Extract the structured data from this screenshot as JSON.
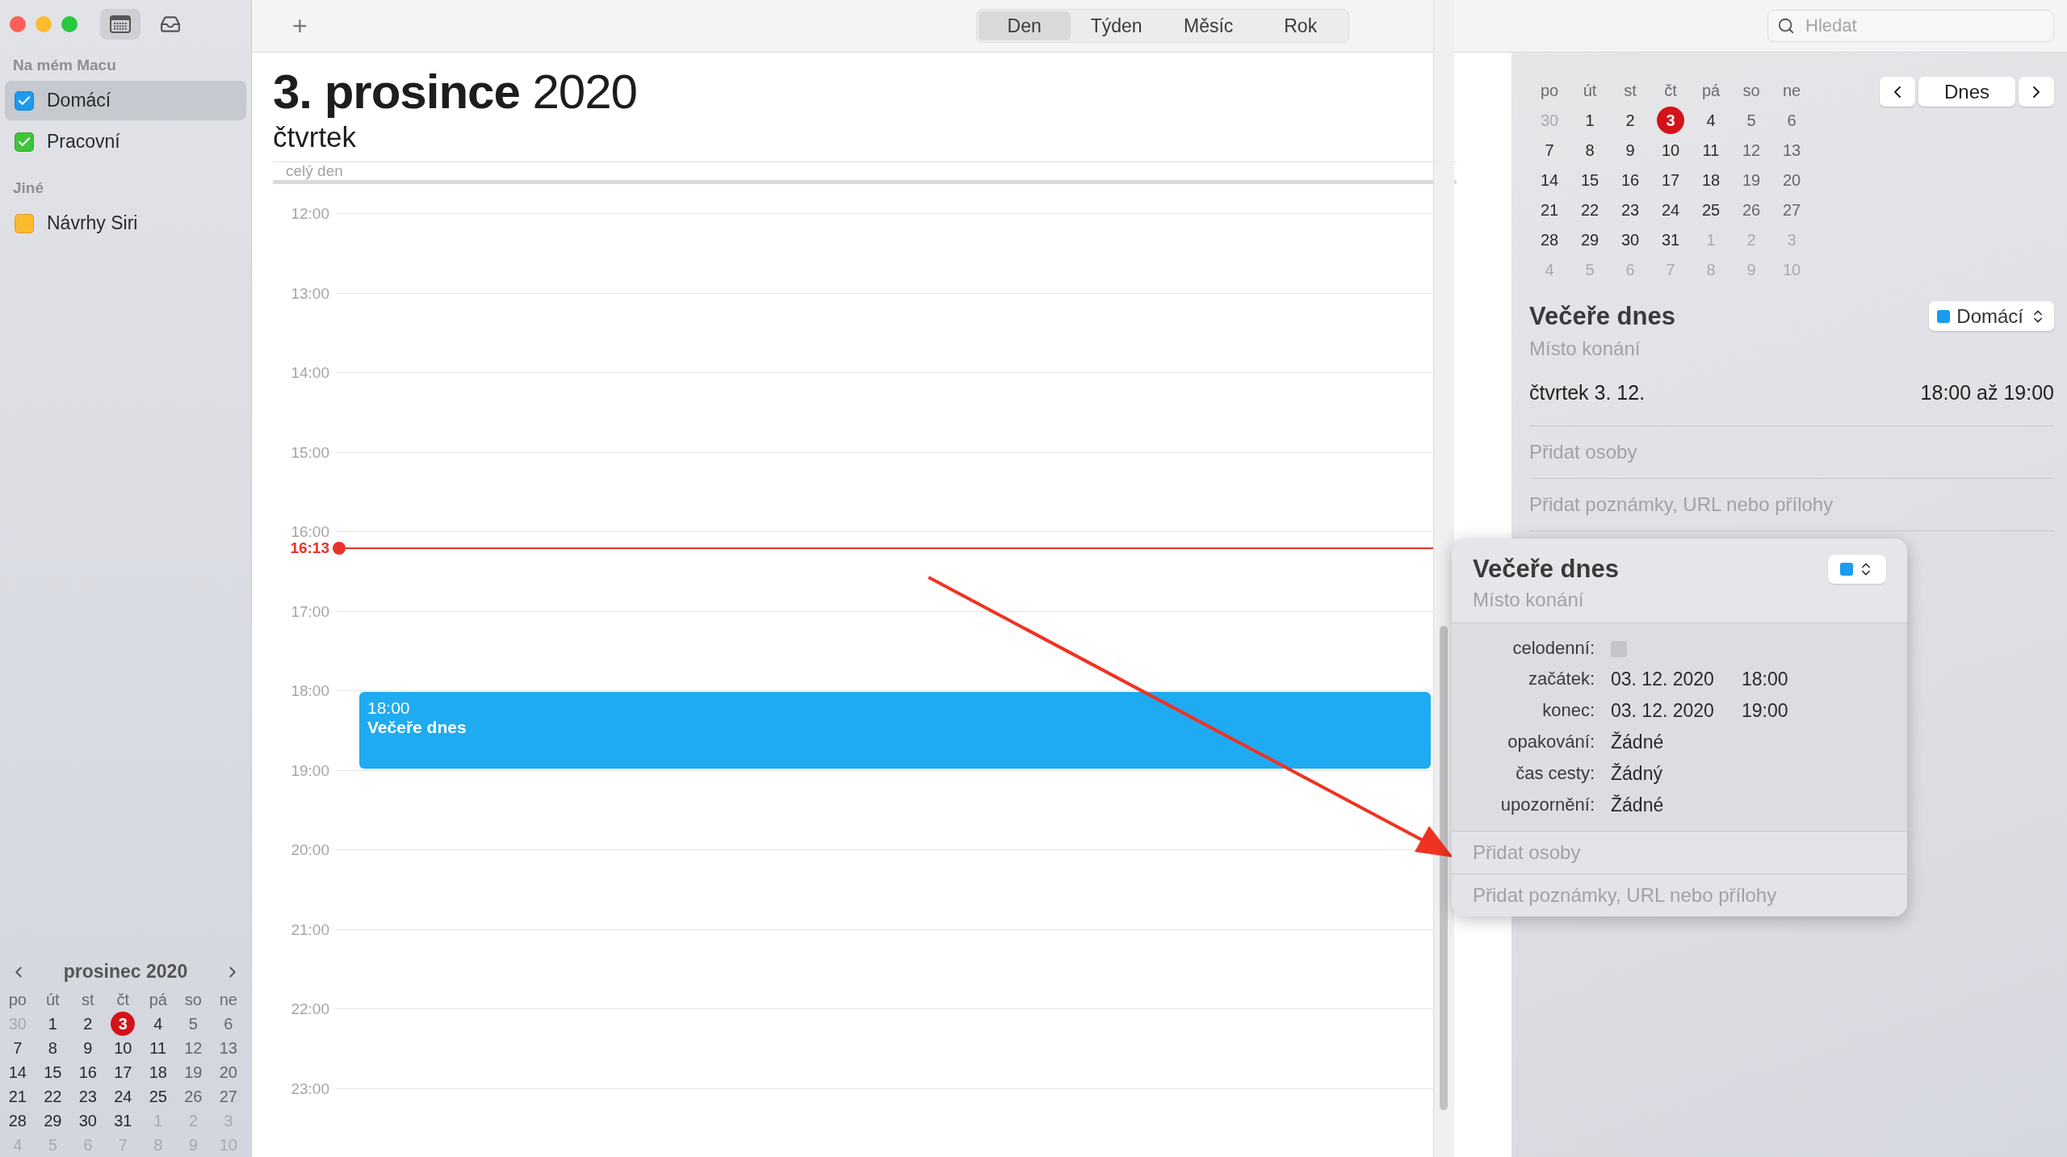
{
  "toolbar": {
    "add_button": "+",
    "view_tabs": [
      {
        "label": "Den",
        "selected": true
      },
      {
        "label": "Týden",
        "selected": false
      },
      {
        "label": "Měsíc",
        "selected": false
      },
      {
        "label": "Rok",
        "selected": false
      }
    ],
    "search": {
      "placeholder": "Hledat"
    }
  },
  "sidebar": {
    "sections": [
      {
        "title": "Na mém Macu",
        "calendars": [
          {
            "name": "Domácí",
            "checked": true,
            "selected": true,
            "color": "#1a9bf0"
          },
          {
            "name": "Pracovní",
            "checked": true,
            "selected": false,
            "color": "#3fc43a"
          }
        ]
      },
      {
        "title": "Jiné",
        "calendars": [
          {
            "name": "Návrhy Siri",
            "checked": false,
            "selected": false,
            "color": "#fdb92d"
          }
        ]
      }
    ],
    "mini_calendar": {
      "title": "prosinec 2020",
      "weekdays": [
        "po",
        "út",
        "st",
        "čt",
        "pá",
        "so",
        "ne"
      ],
      "weeks": [
        [
          {
            "day": "30",
            "in_month": false,
            "today": false
          },
          {
            "day": "1",
            "in_month": true,
            "today": false
          },
          {
            "day": "2",
            "in_month": true,
            "today": false
          },
          {
            "day": "3",
            "in_month": true,
            "today": true
          },
          {
            "day": "4",
            "in_month": true,
            "today": false
          },
          {
            "day": "5",
            "in_month": true,
            "today": false
          },
          {
            "day": "6",
            "in_month": true,
            "today": false
          }
        ],
        [
          {
            "day": "7",
            "in_month": true,
            "today": false
          },
          {
            "day": "8",
            "in_month": true,
            "today": false
          },
          {
            "day": "9",
            "in_month": true,
            "today": false
          },
          {
            "day": "10",
            "in_month": true,
            "today": false
          },
          {
            "day": "11",
            "in_month": true,
            "today": false
          },
          {
            "day": "12",
            "in_month": true,
            "today": false
          },
          {
            "day": "13",
            "in_month": true,
            "today": false
          }
        ],
        [
          {
            "day": "14",
            "in_month": true,
            "today": false
          },
          {
            "day": "15",
            "in_month": true,
            "today": false
          },
          {
            "day": "16",
            "in_month": true,
            "today": false
          },
          {
            "day": "17",
            "in_month": true,
            "today": false
          },
          {
            "day": "18",
            "in_month": true,
            "today": false
          },
          {
            "day": "19",
            "in_month": true,
            "today": false
          },
          {
            "day": "20",
            "in_month": true,
            "today": false
          }
        ],
        [
          {
            "day": "21",
            "in_month": true,
            "today": false
          },
          {
            "day": "22",
            "in_month": true,
            "today": false
          },
          {
            "day": "23",
            "in_month": true,
            "today": false
          },
          {
            "day": "24",
            "in_month": true,
            "today": false
          },
          {
            "day": "25",
            "in_month": true,
            "today": false
          },
          {
            "day": "26",
            "in_month": true,
            "today": false
          },
          {
            "day": "27",
            "in_month": true,
            "today": false
          }
        ],
        [
          {
            "day": "28",
            "in_month": true,
            "today": false
          },
          {
            "day": "29",
            "in_month": true,
            "today": false
          },
          {
            "day": "30",
            "in_month": true,
            "today": false
          },
          {
            "day": "31",
            "in_month": true,
            "today": false
          },
          {
            "day": "1",
            "in_month": false,
            "today": false
          },
          {
            "day": "2",
            "in_month": false,
            "today": false
          },
          {
            "day": "3",
            "in_month": false,
            "today": false
          }
        ],
        [
          {
            "day": "4",
            "in_month": false,
            "today": false
          },
          {
            "day": "5",
            "in_month": false,
            "today": false
          },
          {
            "day": "6",
            "in_month": false,
            "today": false
          },
          {
            "day": "7",
            "in_month": false,
            "today": false
          },
          {
            "day": "8",
            "in_month": false,
            "today": false
          },
          {
            "day": "9",
            "in_month": false,
            "today": false
          },
          {
            "day": "10",
            "in_month": false,
            "today": false
          }
        ]
      ]
    }
  },
  "day_view": {
    "date": "3. prosince",
    "year": "2020",
    "weekday": "čtvrtek",
    "all_day_label": "celý den",
    "hours": [
      "12:00",
      "13:00",
      "14:00",
      "15:00",
      "16:00",
      "17:00",
      "18:00",
      "19:00",
      "20:00",
      "21:00",
      "22:00",
      "23:00"
    ],
    "now_time": "16:13",
    "events": [
      {
        "time": "18:00",
        "title": "Večeře dnes",
        "color": "#1fabf1"
      }
    ]
  },
  "inspector": {
    "mini_calendar": {
      "weekdays": [
        "po",
        "út",
        "st",
        "čt",
        "pá",
        "so",
        "ne"
      ],
      "weeks": [
        [
          {
            "day": "30",
            "in_month": false,
            "today": false
          },
          {
            "day": "1",
            "in_month": true,
            "today": false
          },
          {
            "day": "2",
            "in_month": true,
            "today": false
          },
          {
            "day": "3",
            "in_month": true,
            "today": true
          },
          {
            "day": "4",
            "in_month": true,
            "today": false
          },
          {
            "day": "5",
            "in_month": true,
            "today": false
          },
          {
            "day": "6",
            "in_month": true,
            "today": false
          }
        ],
        [
          {
            "day": "7",
            "in_month": true,
            "today": false
          },
          {
            "day": "8",
            "in_month": true,
            "today": false
          },
          {
            "day": "9",
            "in_month": true,
            "today": false
          },
          {
            "day": "10",
            "in_month": true,
            "today": false
          },
          {
            "day": "11",
            "in_month": true,
            "today": false
          },
          {
            "day": "12",
            "in_month": true,
            "today": false
          },
          {
            "day": "13",
            "in_month": true,
            "today": false
          }
        ],
        [
          {
            "day": "14",
            "in_month": true,
            "today": false
          },
          {
            "day": "15",
            "in_month": true,
            "today": false
          },
          {
            "day": "16",
            "in_month": true,
            "today": false
          },
          {
            "day": "17",
            "in_month": true,
            "today": false
          },
          {
            "day": "18",
            "in_month": true,
            "today": false
          },
          {
            "day": "19",
            "in_month": true,
            "today": false
          },
          {
            "day": "20",
            "in_month": true,
            "today": false
          }
        ],
        [
          {
            "day": "21",
            "in_month": true,
            "today": false
          },
          {
            "day": "22",
            "in_month": true,
            "today": false
          },
          {
            "day": "23",
            "in_month": true,
            "today": false
          },
          {
            "day": "24",
            "in_month": true,
            "today": false
          },
          {
            "day": "25",
            "in_month": true,
            "today": false
          },
          {
            "day": "26",
            "in_month": true,
            "today": false
          },
          {
            "day": "27",
            "in_month": true,
            "today": false
          }
        ],
        [
          {
            "day": "28",
            "in_month": true,
            "today": false
          },
          {
            "day": "29",
            "in_month": true,
            "today": false
          },
          {
            "day": "30",
            "in_month": true,
            "today": false
          },
          {
            "day": "31",
            "in_month": true,
            "today": false
          },
          {
            "day": "1",
            "in_month": false,
            "today": false
          },
          {
            "day": "2",
            "in_month": false,
            "today": false
          },
          {
            "day": "3",
            "in_month": false,
            "today": false
          }
        ],
        [
          {
            "day": "4",
            "in_month": false,
            "today": false
          },
          {
            "day": "5",
            "in_month": false,
            "today": false
          },
          {
            "day": "6",
            "in_month": false,
            "today": false
          },
          {
            "day": "7",
            "in_month": false,
            "today": false
          },
          {
            "day": "8",
            "in_month": false,
            "today": false
          },
          {
            "day": "9",
            "in_month": false,
            "today": false
          },
          {
            "day": "10",
            "in_month": false,
            "today": false
          }
        ]
      ]
    },
    "today_button": "Dnes",
    "title": "Večeře dnes",
    "location_placeholder": "Místo konání",
    "calendar": {
      "name": "Domácí",
      "color": "#1a9bf0"
    },
    "date": "čtvrtek 3. 12.",
    "time": "18:00 až 19:00",
    "add_people": "Přidat osoby",
    "add_notes": "Přidat poznámky, URL nebo přílohy"
  },
  "popover": {
    "title": "Večeře dnes",
    "location_placeholder": "Místo konání",
    "color": "#1a9bf0",
    "fields": [
      {
        "kind": "checkbox",
        "label": "celodenní:",
        "checked": false
      },
      {
        "kind": "datetime",
        "label": "začátek:",
        "date": "03. 12. 2020",
        "time": "18:00"
      },
      {
        "kind": "datetime",
        "label": "konec:",
        "date": "03. 12. 2020",
        "time": "19:00"
      },
      {
        "kind": "text",
        "label": "opakování:",
        "value": "Žádné"
      },
      {
        "kind": "text",
        "label": "čas cesty:",
        "value": "Žádný"
      },
      {
        "kind": "text",
        "label": "upozornění:",
        "value": "Žádné"
      }
    ],
    "add_people": "Přidat osoby",
    "add_notes": "Přidat poznámky, URL nebo přílohy"
  }
}
